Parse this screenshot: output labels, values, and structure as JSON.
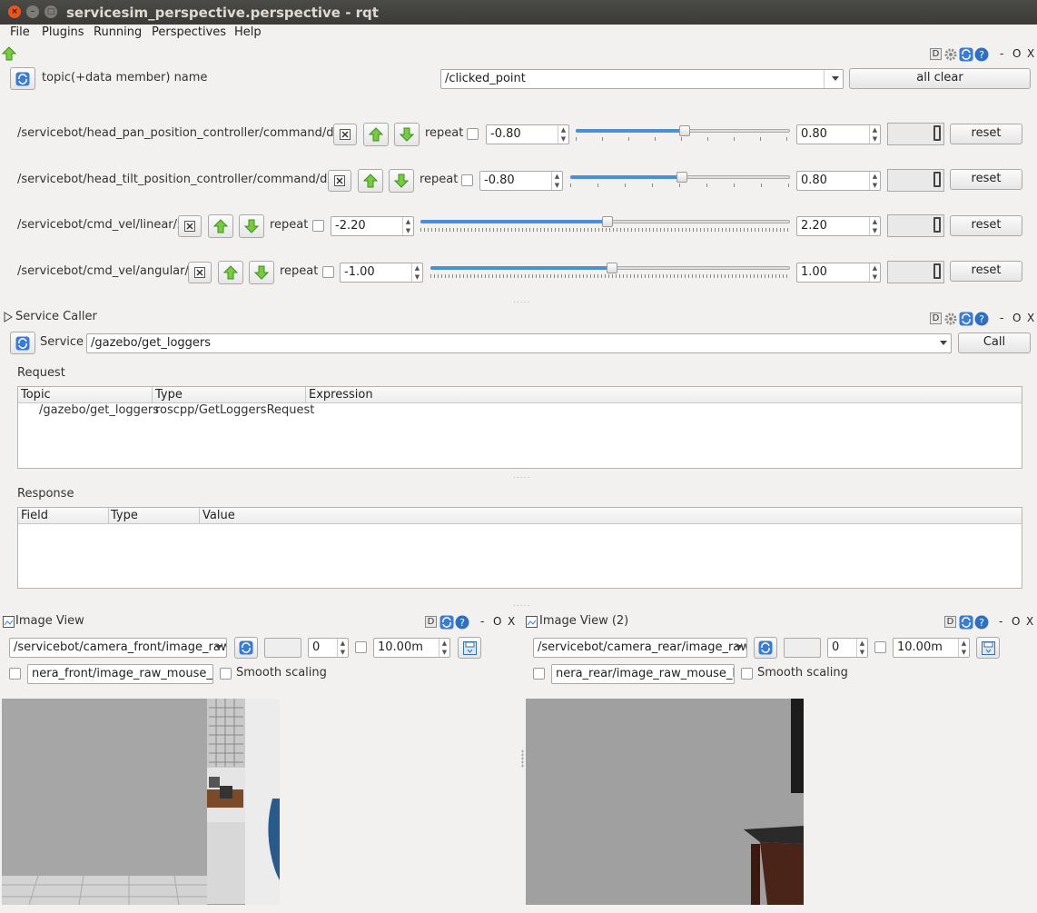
{
  "window": {
    "title": "servicesim_perspective.perspective - rqt"
  },
  "menu": [
    "File",
    "Plugins",
    "Running",
    "Perspectives",
    "Help"
  ],
  "dock_controls": {
    "d": "D",
    "minimize": "-",
    "float": "O",
    "close": "X"
  },
  "publisher": {
    "topic_label": "topic(+data member) name",
    "topic_value": "/clicked_point",
    "all_clear": "all clear",
    "rows": [
      {
        "topic": "/servicebot/head_pan_position_controller/command/data",
        "repeat": "repeat",
        "min": "-0.80",
        "max": "0.80",
        "value": 0.0,
        "reset": "reset"
      },
      {
        "topic": "/servicebot/head_tilt_position_controller/command/data",
        "repeat": "repeat",
        "min": "-0.80",
        "max": "0.80",
        "value": 0.0,
        "reset": "reset"
      },
      {
        "topic": "/servicebot/cmd_vel/linear/x",
        "repeat": "repeat",
        "min": "-2.20",
        "max": "2.20",
        "value": 0.0,
        "reset": "reset"
      },
      {
        "topic": "/servicebot/cmd_vel/angular/z",
        "repeat": "repeat",
        "min": "-1.00",
        "max": "1.00",
        "value": 0.0,
        "reset": "reset"
      }
    ]
  },
  "service_caller": {
    "title": "Service Caller",
    "service_label": "Service",
    "service_value": "/gazebo/get_loggers",
    "call": "Call",
    "request_label": "Request",
    "request_headers": [
      "Topic",
      "Type",
      "Expression"
    ],
    "request_row": {
      "topic": "/gazebo/get_loggers",
      "type": "roscpp/GetLoggersRequest",
      "expression": ""
    },
    "response_label": "Response",
    "response_headers": [
      "Field",
      "Type",
      "Value"
    ]
  },
  "image_views": [
    {
      "title": "Image View",
      "topic": "/servicebot/camera_front/image_raw",
      "blank": "",
      "zero": "0",
      "range": "10.00m",
      "mouse_topic": "nera_front/image_raw_mouse_left",
      "smooth": "Smooth scaling"
    },
    {
      "title": "Image View (2)",
      "topic": "/servicebot/camera_rear/image_raw",
      "blank": "",
      "zero": "0",
      "range": "10.00m",
      "mouse_topic": "nera_rear/image_raw_mouse_left",
      "smooth": "Smooth scaling"
    }
  ]
}
